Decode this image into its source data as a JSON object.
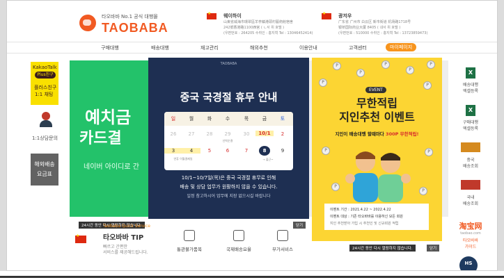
{
  "logo": {
    "tagline": "타오바바 No.1 공식 대행몰",
    "name": "TAOBABA"
  },
  "addresses": [
    {
      "city": "웨이하이",
      "lines": [
        "山東省威海市環翠區羊亭鎮港頭村藝術館宿舍",
        "242號香港路1100西宮 ( ㄴ서 위 호텔 )",
        "(우편번호 : 264205 수취인 : 홍지혁 Tel : 13046452414)"
      ]
    },
    {
      "city": "광저우",
      "lines": [
        "广东省 广州市 白云区 新市街道 机场路1718号",
        "银桥国际商业大厦 8405 ( 내서 위 호텔 )",
        "(우편번호 : 510000 수취인 : 홍지혁 Tel : 13723859473)"
      ]
    }
  ],
  "nav": [
    "구매대행",
    "배송대행",
    "재고관리",
    "해외추천",
    "이용안내",
    "고객센터",
    "마이페이지"
  ],
  "left_sidebar": {
    "kakao_top": "KakaoTalk",
    "kakao_pill": "Plus친구",
    "kakao_line1": "플러스친구",
    "kakao_line2": "1:1 채팅",
    "counsel": "1:1상담문의",
    "fee_line1": "해외배송",
    "fee_line2": "요금표"
  },
  "green_banner": {
    "line1": "예치금",
    "line2": "카드결",
    "line3": "네이버 아이디로 간"
  },
  "holiday_popup": {
    "brand": "TAOBABA",
    "title": "중국 국경절 휴무 안내",
    "weekdays": [
      "일",
      "월",
      "화",
      "수",
      "목",
      "금",
      "토"
    ],
    "week1": [
      "26",
      "27",
      "28",
      "29",
      "30",
      "10/1",
      "2"
    ],
    "week2": [
      "3",
      "4",
      "5",
      "6",
      "7",
      "8",
      "9"
    ],
    "note_under_week1": "선착순결",
    "note_week2_left": "연휴 이월결제일",
    "note_week2_right": "→ 출근~",
    "line1": "10/1~10/7일(목)은 중국 국경절 휴무로 인해",
    "line2": "배송 및 상담 업무가 원활하지 않을 수 있습니다.",
    "line3": "일정 참고하시어 업무에 지장 없으시길 바랍니다",
    "dismiss": "24시간 동안 다시 열람하지 않습니다.",
    "close": "닫기"
  },
  "event_popup": {
    "badge": "EVENT",
    "title1": "무한적립",
    "title2": "지인추천 이벤트",
    "subtitle_prefix": "지인이 배송대행 할때마다",
    "subtitle_emph": "300P 무한적립!",
    "period_label": "이벤트 기간 : 2021.4.22 ~ 2022.4.22",
    "target_label": "이벤트 대상 : 기존 타오바바를 이용하신 모든 회원",
    "note": "지인 추천받아 가입 시 추천인 및 신규회원 적립",
    "dismiss": "24시간 동안 다시 열람하지 않습니다.",
    "close": "닫기"
  },
  "right_sidebar": [
    {
      "icon": "excel-icon",
      "line1": "배송대행",
      "line2": "엑셀등록"
    },
    {
      "icon": "excel-icon",
      "line1": "구매대행",
      "line2": "엑셀등록"
    },
    {
      "icon": "truck-icon",
      "line1": "중국",
      "line2": "배송조회"
    },
    {
      "icon": "truck-icon",
      "line1": "국내",
      "line2": "배송조회"
    },
    {
      "icon": "taobao-icon",
      "line1": "타오바바",
      "line2": "가이드",
      "brand": "淘宝网",
      "brand_sub": "taobao.com"
    }
  ],
  "tip": {
    "label": "Taobaba Quick Service",
    "title": "타오바바 TIP",
    "desc1": "빠르고 간편한",
    "desc2": "서비스를 제공해드립니다."
  },
  "services": [
    "통관불가품목",
    "국제배송요율",
    "부가서비스"
  ],
  "hs_badge": "HS",
  "colors": {
    "brand": "#f15a22",
    "accent": "#f7941d",
    "green": "#23c26a",
    "navy": "#1e2f52",
    "yellow": "#fcd533"
  }
}
